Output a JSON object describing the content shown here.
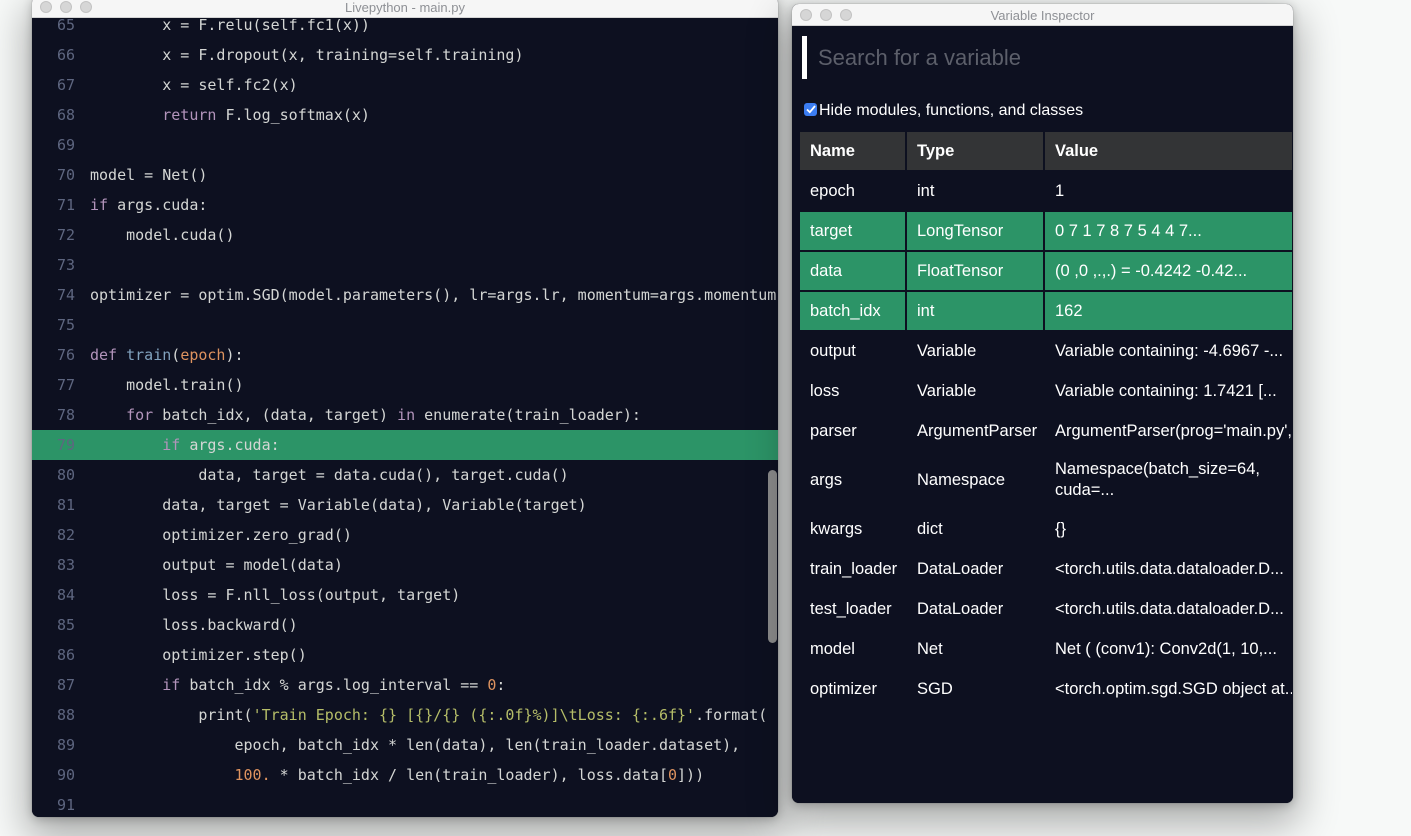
{
  "colors": {
    "page_bg": "#f7f9f8",
    "editor_bg": "#0d1020",
    "titlebar_bg": "#f6f6f6",
    "title_text": "#8e9095",
    "highlight_green": "#2c9467",
    "table_header_bg": "#333436",
    "text_white": "#ffffff",
    "code_text": "#d4d6d4",
    "line_number": "#5e6680",
    "syntax_keyword": "#b294bb",
    "syntax_function": "#81a2be",
    "syntax_number": "#de935f",
    "syntax_string": "#b5bd68",
    "placeholder_text": "#5c5f6a",
    "checkbox_blue": "#3b7df2",
    "scrollbar": "#8b8b8b"
  },
  "editor": {
    "title": "Livepython - main.py",
    "highlight_line": 79,
    "lines": [
      {
        "no": 65,
        "segs": [
          [
            "p",
            "        x = F.relu(self.fc1(x))"
          ]
        ]
      },
      {
        "no": 66,
        "segs": [
          [
            "p",
            "        x = F.dropout(x, training=self.training)"
          ]
        ]
      },
      {
        "no": 67,
        "segs": [
          [
            "p",
            "        x = self.fc2(x)"
          ]
        ]
      },
      {
        "no": 68,
        "segs": [
          [
            "p",
            "        "
          ],
          [
            "k",
            "return"
          ],
          [
            "p",
            " F.log_softmax(x)"
          ]
        ]
      },
      {
        "no": 69,
        "segs": []
      },
      {
        "no": 70,
        "segs": [
          [
            "p",
            "model = Net()"
          ]
        ]
      },
      {
        "no": 71,
        "segs": [
          [
            "k",
            "if"
          ],
          [
            "p",
            " args.cuda:"
          ]
        ]
      },
      {
        "no": 72,
        "segs": [
          [
            "p",
            "    model.cuda()"
          ]
        ]
      },
      {
        "no": 73,
        "segs": []
      },
      {
        "no": 74,
        "segs": [
          [
            "p",
            "optimizer = optim.SGD(model.parameters(), lr=args.lr, momentum=args.momentum"
          ]
        ]
      },
      {
        "no": 75,
        "segs": []
      },
      {
        "no": 76,
        "segs": [
          [
            "k",
            "def"
          ],
          [
            "p",
            " "
          ],
          [
            "f",
            "train"
          ],
          [
            "p",
            "("
          ],
          [
            "o",
            "epoch"
          ],
          [
            "p",
            "):"
          ]
        ]
      },
      {
        "no": 77,
        "segs": [
          [
            "p",
            "    model.train()"
          ]
        ]
      },
      {
        "no": 78,
        "segs": [
          [
            "p",
            "    "
          ],
          [
            "k",
            "for"
          ],
          [
            "p",
            " batch_idx, (data, target) "
          ],
          [
            "k",
            "in"
          ],
          [
            "p",
            " enumerate(train_loader):"
          ]
        ]
      },
      {
        "no": 79,
        "segs": [
          [
            "p",
            "        "
          ],
          [
            "k",
            "if"
          ],
          [
            "p",
            " args.cuda:"
          ]
        ]
      },
      {
        "no": 80,
        "segs": [
          [
            "p",
            "            data, target = data.cuda(), target.cuda()"
          ]
        ]
      },
      {
        "no": 81,
        "segs": [
          [
            "p",
            "        data, target = Variable(data), Variable(target)"
          ]
        ]
      },
      {
        "no": 82,
        "segs": [
          [
            "p",
            "        optimizer.zero_grad()"
          ]
        ]
      },
      {
        "no": 83,
        "segs": [
          [
            "p",
            "        output = model(data)"
          ]
        ]
      },
      {
        "no": 84,
        "segs": [
          [
            "p",
            "        loss = F.nll_loss(output, target)"
          ]
        ]
      },
      {
        "no": 85,
        "segs": [
          [
            "p",
            "        loss.backward()"
          ]
        ]
      },
      {
        "no": 86,
        "segs": [
          [
            "p",
            "        optimizer.step()"
          ]
        ]
      },
      {
        "no": 87,
        "segs": [
          [
            "p",
            "        "
          ],
          [
            "k",
            "if"
          ],
          [
            "p",
            " batch_idx % args.log_interval == "
          ],
          [
            "o",
            "0"
          ],
          [
            "p",
            ":"
          ]
        ]
      },
      {
        "no": 88,
        "segs": [
          [
            "p",
            "            print("
          ],
          [
            "s",
            "'Train Epoch: {} [{}/{} ({:.0f}%)]\\tLoss: {:.6f}'"
          ],
          [
            "p",
            ".format("
          ]
        ]
      },
      {
        "no": 89,
        "segs": [
          [
            "p",
            "                epoch, batch_idx * len(data), len(train_loader.dataset),"
          ]
        ]
      },
      {
        "no": 90,
        "segs": [
          [
            "p",
            "                "
          ],
          [
            "o",
            "100."
          ],
          [
            "p",
            " * batch_idx / len(train_loader), loss.data["
          ],
          [
            "o",
            "0"
          ],
          [
            "p",
            "]))"
          ]
        ]
      },
      {
        "no": 91,
        "segs": []
      }
    ]
  },
  "inspector": {
    "title": "Variable Inspector",
    "search_placeholder": "Search for a variable",
    "checkbox_label": "Hide modules, functions, and classes",
    "checkbox_checked": true,
    "table": {
      "headers": [
        "Name",
        "Type",
        "Value"
      ],
      "rows": [
        {
          "name": "epoch",
          "type": "int",
          "value": "1",
          "highlight": false
        },
        {
          "name": "target",
          "type": "LongTensor",
          "value": "0 7 1 7 8 7 5 4 4 7...",
          "highlight": true
        },
        {
          "name": "data",
          "type": "FloatTensor",
          "value": "(0 ,0 ,.,.) = -0.4242 -0.42...",
          "highlight": true
        },
        {
          "name": "batch_idx",
          "type": "int",
          "value": "162",
          "highlight": true
        },
        {
          "name": "output",
          "type": "Variable",
          "value": "Variable containing: -4.6967 -...",
          "highlight": false
        },
        {
          "name": "loss",
          "type": "Variable",
          "value": "Variable containing: 1.7421 [...",
          "highlight": false
        },
        {
          "name": "parser",
          "type": "ArgumentParser",
          "value": "ArgumentParser(prog='main.py',...",
          "highlight": false
        },
        {
          "name": "args",
          "type": "Namespace",
          "value": "Namespace(batch_size=64, cuda=...",
          "highlight": false,
          "wrap": true
        },
        {
          "name": "kwargs",
          "type": "dict",
          "value": "{}",
          "highlight": false
        },
        {
          "name": "train_loader",
          "type": "DataLoader",
          "value": "<torch.utils.data.dataloader.D...",
          "highlight": false
        },
        {
          "name": "test_loader",
          "type": "DataLoader",
          "value": "<torch.utils.data.dataloader.D...",
          "highlight": false
        },
        {
          "name": "model",
          "type": "Net",
          "value": "Net ( (conv1): Conv2d(1, 10,...",
          "highlight": false
        },
        {
          "name": "optimizer",
          "type": "SGD",
          "value": "<torch.optim.sgd.SGD object at...",
          "highlight": false
        }
      ]
    }
  }
}
